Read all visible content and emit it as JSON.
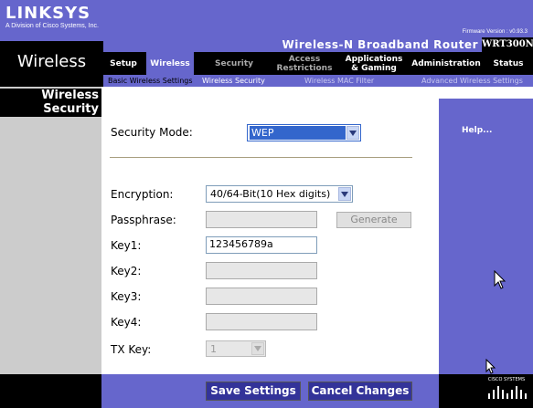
{
  "brand": {
    "logo": "LINKSYS",
    "subtitle": "A Division of Cisco Systems, Inc.",
    "firmware": "Firmware Version : v0.93.3",
    "product_name": "Wireless-N Broadband Router",
    "model": "WRT300N"
  },
  "section_title": "Wireless",
  "nav": {
    "tabs": [
      {
        "label": "Setup"
      },
      {
        "label": "Wireless"
      },
      {
        "label": "Security"
      },
      {
        "label": "Access Restrictions"
      },
      {
        "label": "Applications & Gaming"
      },
      {
        "label": "Administration"
      },
      {
        "label": "Status"
      }
    ],
    "subtabs": [
      {
        "label": "Basic Wireless Settings"
      },
      {
        "label": "Wireless Security"
      },
      {
        "label": "Wireless MAC Filter"
      },
      {
        "label": "Advanced Wireless Settings"
      }
    ]
  },
  "left_title": "Wireless Security",
  "help_link": "Help...",
  "form": {
    "security_mode_label": "Security Mode:",
    "security_mode_value": "WEP",
    "encryption_label": "Encryption:",
    "encryption_value": "40/64-Bit(10 Hex digits)",
    "passphrase_label": "Passphrase:",
    "passphrase_value": "",
    "generate_label": "Generate",
    "key1_label": "Key1:",
    "key1_value": "123456789a",
    "key2_label": "Key2:",
    "key2_value": "",
    "key3_label": "Key3:",
    "key3_value": "",
    "key4_label": "Key4:",
    "key4_value": "",
    "txkey_label": "TX Key:",
    "txkey_value": "1"
  },
  "footer": {
    "save_label": "Save Settings",
    "cancel_label": "Cancel Changes",
    "cisco_label": "CISCO SYSTEMS"
  },
  "colors": {
    "accent": "#6666cc",
    "selected": "#3366cc"
  }
}
